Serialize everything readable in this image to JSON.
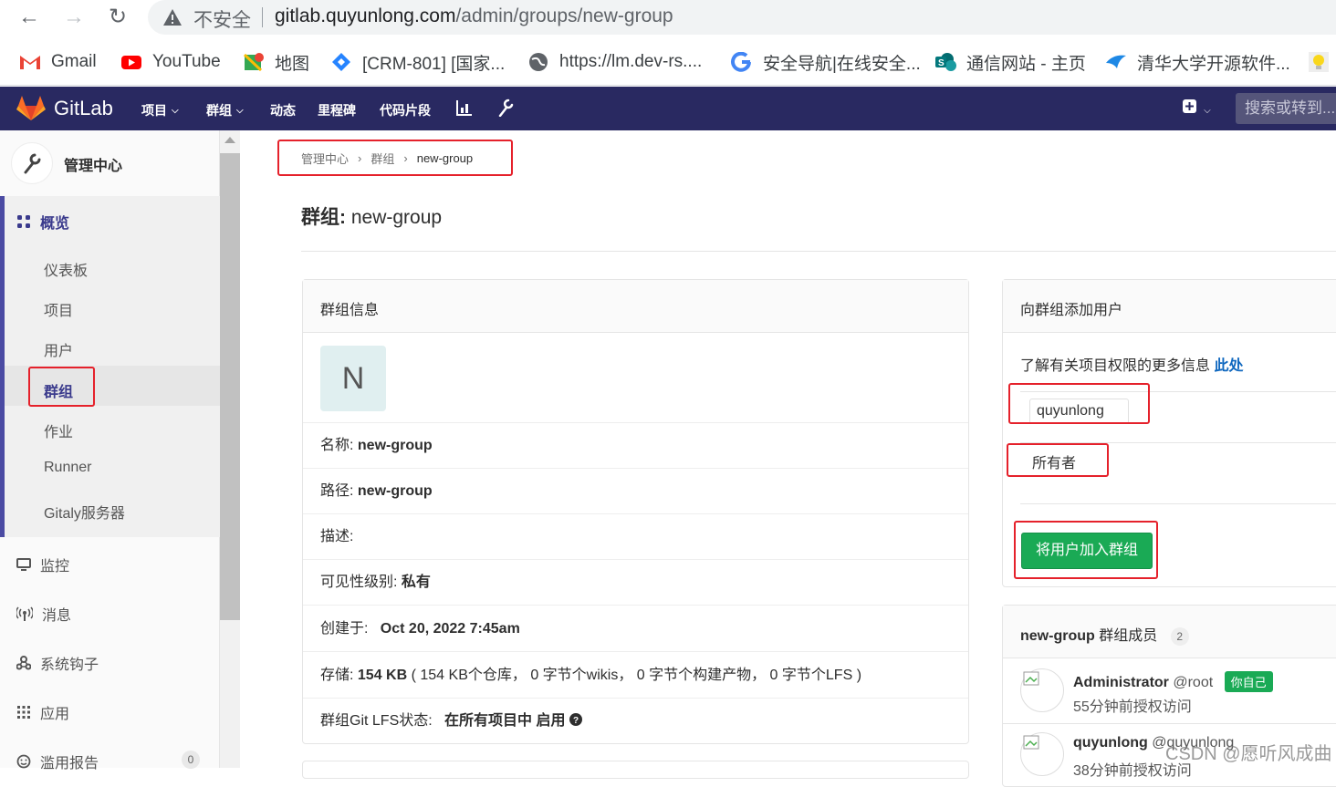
{
  "browser": {
    "insecure_label": "不安全",
    "url_host": "gitlab.quyunlong.com",
    "url_path": "/admin/groups/new-group",
    "bookmarks": [
      {
        "label": "Gmail",
        "icon": "gmail-icon",
        "color": "#ea4335"
      },
      {
        "label": "YouTube",
        "icon": "youtube-icon",
        "color": "#ff0000"
      },
      {
        "label": "地图",
        "icon": "maps-icon",
        "color": "#34a853"
      },
      {
        "label": "[CRM-801] [国家...",
        "icon": "jira-icon",
        "color": "#2684ff"
      },
      {
        "label": "https://lm.dev-rs....",
        "icon": "globe-icon",
        "color": "#5f6368"
      },
      {
        "label": "安全导航|在线安全...",
        "icon": "google-icon",
        "color": "#4285f4"
      },
      {
        "label": "通信网站 - 主页",
        "icon": "sharepoint-icon",
        "color": "#038387"
      },
      {
        "label": "清华大学开源软件...",
        "icon": "bird-icon",
        "color": "#1e88e5"
      }
    ]
  },
  "navbar": {
    "brand": "GitLab",
    "menu": [
      {
        "label": "项目",
        "dropdown": true
      },
      {
        "label": "群组",
        "dropdown": true
      },
      {
        "label": "动态",
        "dropdown": false
      },
      {
        "label": "里程碑",
        "dropdown": false
      },
      {
        "label": "代码片段",
        "dropdown": false
      }
    ],
    "search_placeholder": "搜索或转到..."
  },
  "sidebar": {
    "title": "管理中心",
    "section": "概览",
    "items": [
      "仪表板",
      "项目",
      "用户",
      "群组",
      "作业",
      "Runner",
      "Gitaly服务器"
    ],
    "active_item": "群组",
    "categories": [
      "监控",
      "消息",
      "系统钩子",
      "应用",
      "滥用报告"
    ],
    "abuse_count": "0"
  },
  "breadcrumb": [
    "管理中心",
    "群组",
    "new-group"
  ],
  "page_title_prefix": "群组:",
  "page_title_name": "new-group",
  "group_info": {
    "header": "群组信息",
    "avatar_letter": "N",
    "name_label": "名称:",
    "name_value": "new-group",
    "path_label": "路径:",
    "path_value": "new-group",
    "desc_label": "描述:",
    "visibility_label": "可见性级别:",
    "visibility_value": "私有",
    "created_label": "创建于:",
    "created_value": "Oct 20, 2022 7:45am",
    "storage_label": "存储:",
    "storage_value": "154 KB",
    "storage_detail": "( 154 KB个仓库， 0 字节个wikis， 0 字节个构建产物， 0 字节个LFS )",
    "lfs_label": "群组Git LFS状态:",
    "lfs_value": "在所有项目中 启用"
  },
  "add_user": {
    "header": "向群组添加用户",
    "info_text": "了解有关项目权限的更多信息",
    "info_link": "此处",
    "user_value": "quyunlong",
    "role_value": "所有者",
    "submit_label": "将用户加入群组"
  },
  "members": {
    "group_name": "new-group",
    "title_suffix": "群组成员",
    "count": "2",
    "list": [
      {
        "name": "Administrator",
        "handle": "@root",
        "badge": "你自己",
        "sub": "55分钟前授权访问"
      },
      {
        "name": "quyunlong",
        "handle": "@quyunlong",
        "badge": "",
        "sub": "38分钟前授权访问"
      }
    ]
  },
  "watermark": "CSDN @愿听风成曲",
  "colors": {
    "navbar": "#292961",
    "accent_green": "#1aaa55",
    "link_blue": "#1068bf",
    "highlight_red": "#e5212b"
  }
}
